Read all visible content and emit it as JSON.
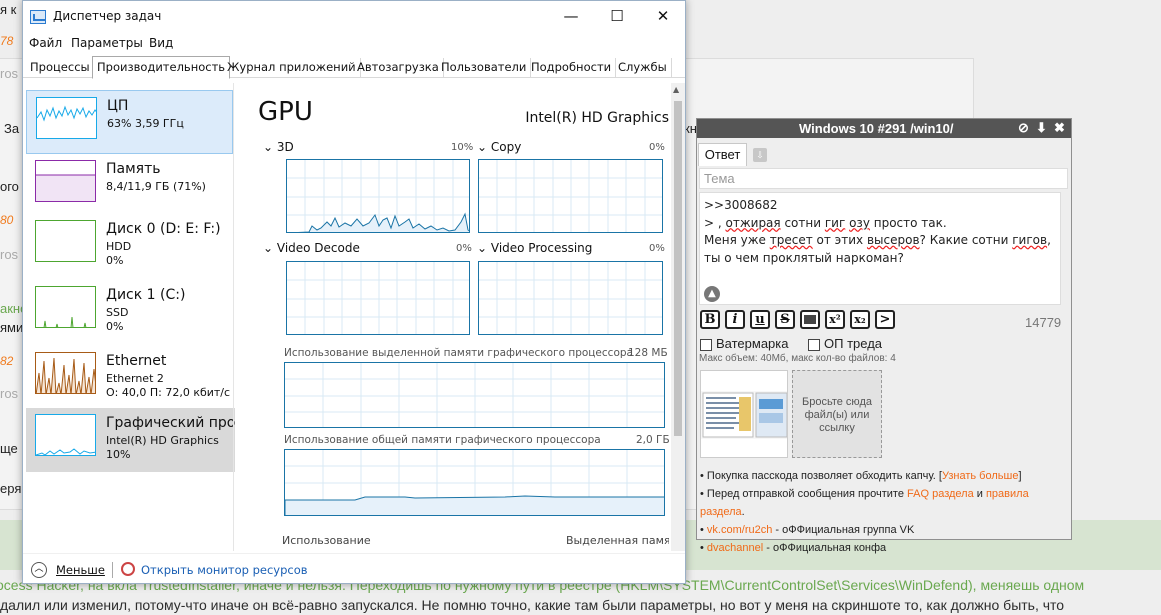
{
  "background": {
    "left_fragments": [
      "я к",
      "78",
      "ros",
      "За",
      "ого",
      "80",
      "ros",
      "акно",
      "ями",
      "82",
      "ros",
      "ще",
      "еря"
    ],
    "right_fragments": [
      "кн",
      "ос"
    ],
    "bottom_line1": "ocess Hacker, на вкла  TrustedInstaller, иначе и нельзя. Переходишь по нужному пути в реестре (HKLM\\SYSTEM\\CurrentControlSet\\Services\\WinDefend), меняешь одном",
    "bottom_line2": "далил или изменил, потому-что иначе он всё-равно запускался. Не помню точно, какие там были параметры, но вот у меня на скриншоте то, как должно быть, что"
  },
  "taskmanager": {
    "title": "Диспетчер задач",
    "window_buttons": {
      "minimize": "—",
      "maximize": "☐",
      "close": "✕"
    },
    "menu": [
      "Файл",
      "Параметры",
      "Вид"
    ],
    "tabs": [
      "Процессы",
      "Производительность",
      "Журнал приложений",
      "Автозагрузка",
      "Пользователи",
      "Подробности",
      "Службы"
    ],
    "sidebar": [
      {
        "name": "ЦП",
        "line2": "63% 3,59 ГГц",
        "line3": ""
      },
      {
        "name": "Память",
        "line2": "8,4/11,9 ГБ (71%)",
        "line3": ""
      },
      {
        "name": "Диск 0 (D: E: F:)",
        "line2": "HDD",
        "line3": "0%"
      },
      {
        "name": "Диск 1 (C:)",
        "line2": "SSD",
        "line3": "0%"
      },
      {
        "name": "Ethernet",
        "line2": "Ethernet 2",
        "line3": "О: 40,0  П: 72,0 кбит/с"
      },
      {
        "name": "Графический про",
        "line2": "Intel(R) HD Graphics",
        "line3": "10%"
      }
    ],
    "gpu": {
      "heading": "GPU",
      "adapter": "Intel(R) HD Graphics",
      "engines": [
        {
          "label": "3D",
          "pct": "10%"
        },
        {
          "label": "Copy",
          "pct": "0%"
        },
        {
          "label": "Video Decode",
          "pct": "0%"
        },
        {
          "label": "Video Processing",
          "pct": "0%"
        }
      ],
      "dedicated_label": "Использование выделенной памяти графического процессора",
      "dedicated_max": "128 МБ",
      "shared_label": "Использование общей памяти графического процессора",
      "shared_max": "2,0 ГБ",
      "usage_label": "Использование",
      "dedicated_mem_label": "Выделенная памя"
    },
    "footer": {
      "less": "Меньше",
      "monitor": "Открыть монитор ресурсов"
    }
  },
  "reply": {
    "title": "Windows 10 #291 /win10/",
    "tab_answer": "Ответ",
    "subject_placeholder": "Тема",
    "text_line1": ">>3008682",
    "text_line2a": "> , ",
    "text_line2b": "отжирая",
    "text_line2c": " сотни ",
    "text_line2d": "гиг",
    "text_line2e": " ",
    "text_line2f": "озу",
    "text_line2g": " просто так.",
    "text_line3a": "Меня уже ",
    "text_line3b": "тресет",
    "text_line3c": " от этих ",
    "text_line3d": "высеров",
    "text_line3e": "? Какие сотни ",
    "text_line3f": "гигов",
    "text_line3g": ",",
    "text_line4": "ты о чем проклятый наркоман?",
    "format_buttons": [
      "B",
      "i",
      "u",
      "S",
      "",
      "x²",
      "x₂",
      ">"
    ],
    "char_count": "14779",
    "watermark_label": "Ватермарка",
    "op_label": "ОП треда",
    "limits": "Макс объем: 40Мб, макс кол-во файлов: 4",
    "drop_text": "Бросьте сюда файл(ы) или ссылку",
    "rules": [
      {
        "a": "Покупка пасскода позволяет обходить капчу. [",
        "link": "Узнать больше",
        "b": "]"
      },
      {
        "a": "Перед отправкой сообщения прочтите ",
        "link": "FAQ раздела",
        "b": " и ",
        "link2": "правила раздела",
        "c": "."
      },
      {
        "a": "",
        "link": "vk.com/ru2ch",
        "b": " - оФФициальная группа VK"
      },
      {
        "a": "",
        "link": "dvachannel",
        "b": " - оФФициальная конфа"
      }
    ]
  }
}
